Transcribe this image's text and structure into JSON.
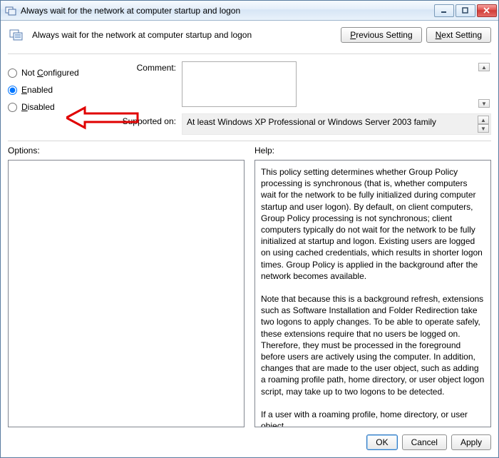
{
  "window": {
    "title": "Always wait for the network at computer startup and logon"
  },
  "header": {
    "title": "Always wait for the network at computer startup and logon",
    "previous_btn": "Previous Setting",
    "next_btn": "Next Setting"
  },
  "state": {
    "not_configured_label": "Not Configured",
    "enabled_label": "Enabled",
    "disabled_label": "Disabled",
    "selected": "enabled"
  },
  "fields": {
    "comment_label": "Comment:",
    "comment_value": "",
    "supported_label": "Supported on:",
    "supported_value": "At least Windows XP Professional or Windows Server 2003 family"
  },
  "lower": {
    "options_label": "Options:",
    "options_content": "",
    "help_label": "Help:",
    "help_content": "This policy setting determines whether Group Policy processing is synchronous (that is, whether computers wait for the network to be fully initialized during computer startup and user logon). By default, on client computers, Group Policy processing is not synchronous; client computers typically do not wait for the network to be fully initialized at startup and logon. Existing users are logged on using cached credentials, which results in shorter logon times. Group Policy is applied in the background after the network becomes available.\n\nNote that because this is a background refresh, extensions such as Software Installation and Folder Redirection take two logons to apply changes. To be able to operate safely, these extensions require that no users be logged on. Therefore, they must be processed in the foreground before users are actively using the computer. In addition, changes that are made to the user object, such as adding a roaming profile path, home directory, or user object logon script, may take up to two logons to be detected.\n\nIf a user with a roaming profile, home directory, or user object"
  },
  "footer": {
    "ok": "OK",
    "cancel": "Cancel",
    "apply": "Apply"
  }
}
